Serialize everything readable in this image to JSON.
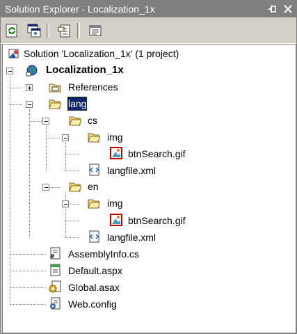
{
  "window": {
    "title": "Solution Explorer - Localization_1x"
  },
  "titlebar_buttons": {
    "pin": "⊣",
    "close": "×"
  },
  "toolbar": {
    "buttons": [
      "refresh-icon",
      "show-all-files-icon",
      "properties-icon",
      "view-code-icon"
    ]
  },
  "tree": {
    "solution": "Solution 'Localization_1x' (1 project)",
    "project": "Localization_1x",
    "references": "References",
    "lang": "lang",
    "cs": "cs",
    "cs_img": "img",
    "cs_gif": "btnSearch.gif",
    "cs_xml": "langfile.xml",
    "en": "en",
    "en_img": "img",
    "en_gif": "btnSearch.gif",
    "en_xml": "langfile.xml",
    "assemblyinfo": "AssemblyInfo.cs",
    "default": "Default.aspx",
    "global": "Global.asax",
    "webconfig": "Web.config"
  }
}
